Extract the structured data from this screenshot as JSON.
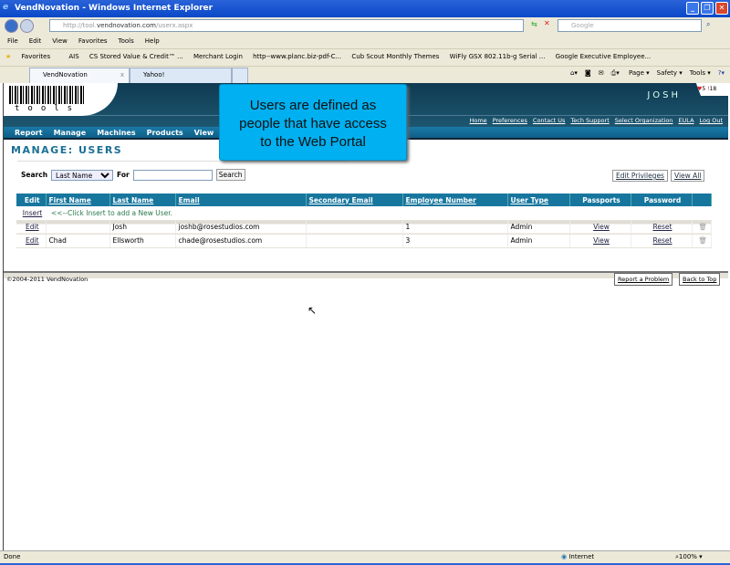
{
  "browser": {
    "title": "VendNovation - Windows Internet Explorer",
    "url_prefix": "http://tool.",
    "url_domain": "vendnovation.com",
    "url_path": "/userx.aspx",
    "search_placeholder": "Google",
    "menu": [
      "File",
      "Edit",
      "View",
      "Favorites",
      "Tools",
      "Help"
    ],
    "favorites_label": "Favorites",
    "favorites": [
      "AIS",
      "CS Stored Value & Credit™ ...",
      "Merchant Login",
      "http--www.planc.biz-pdf-C...",
      "Cub Scout Monthly Themes",
      "WiFly GSX 802.11b-g Serial ...",
      "Google Executive Employee..."
    ],
    "tabs": [
      "VendNovation",
      "Yahoo!"
    ],
    "commands": [
      "Page ▾",
      "Safety ▾",
      "Tools ▾"
    ],
    "status": "Done",
    "zone": "Internet",
    "zoom": "100%"
  },
  "header": {
    "user": "JOSH",
    "hearts": "5",
    "alerts": "18",
    "logo_text": "tools",
    "top_links": [
      "Home",
      "Preferences",
      "Contact Us",
      "Tech Support",
      "Select Organization",
      "EULA",
      "Log Out"
    ],
    "nav": [
      "Report",
      "Manage",
      "Machines",
      "Products",
      "View"
    ]
  },
  "page": {
    "title": "MANAGE: USERS",
    "search_label": "Search",
    "search_by": "Last Name",
    "for_label": "For",
    "for_value": "",
    "search_button": "Search",
    "edit_privileges": "Edit Privileges",
    "view_all": "View All"
  },
  "table": {
    "headers": [
      "Edit",
      "First Name",
      "Last Name",
      "Email",
      "Secondary Email",
      "Employee Number",
      "User Type",
      "Passports",
      "Password"
    ],
    "insert_label": "Insert",
    "insert_hint": "<<--Click Insert to add a New User.",
    "rows": [
      {
        "edit": "Edit",
        "first": "",
        "last": "Josh",
        "email": "joshb@rosestudios.com",
        "secondary": "",
        "employee": "1",
        "type": "Admin",
        "passports": "View",
        "password": "Reset"
      },
      {
        "edit": "Edit",
        "first": "Chad",
        "last": "Ellsworth",
        "email": "chade@rosestudios.com",
        "secondary": "",
        "employee": "3",
        "type": "Admin",
        "passports": "View",
        "password": "Reset"
      }
    ]
  },
  "footer": {
    "copyright": "©2004-2011 VendNovation",
    "report": "Report a Problem",
    "back_to_top": "Back to Top"
  },
  "tooltip": {
    "line1": "Users are defined as",
    "line2": "people that have access",
    "line3": "to the Web Portal"
  }
}
